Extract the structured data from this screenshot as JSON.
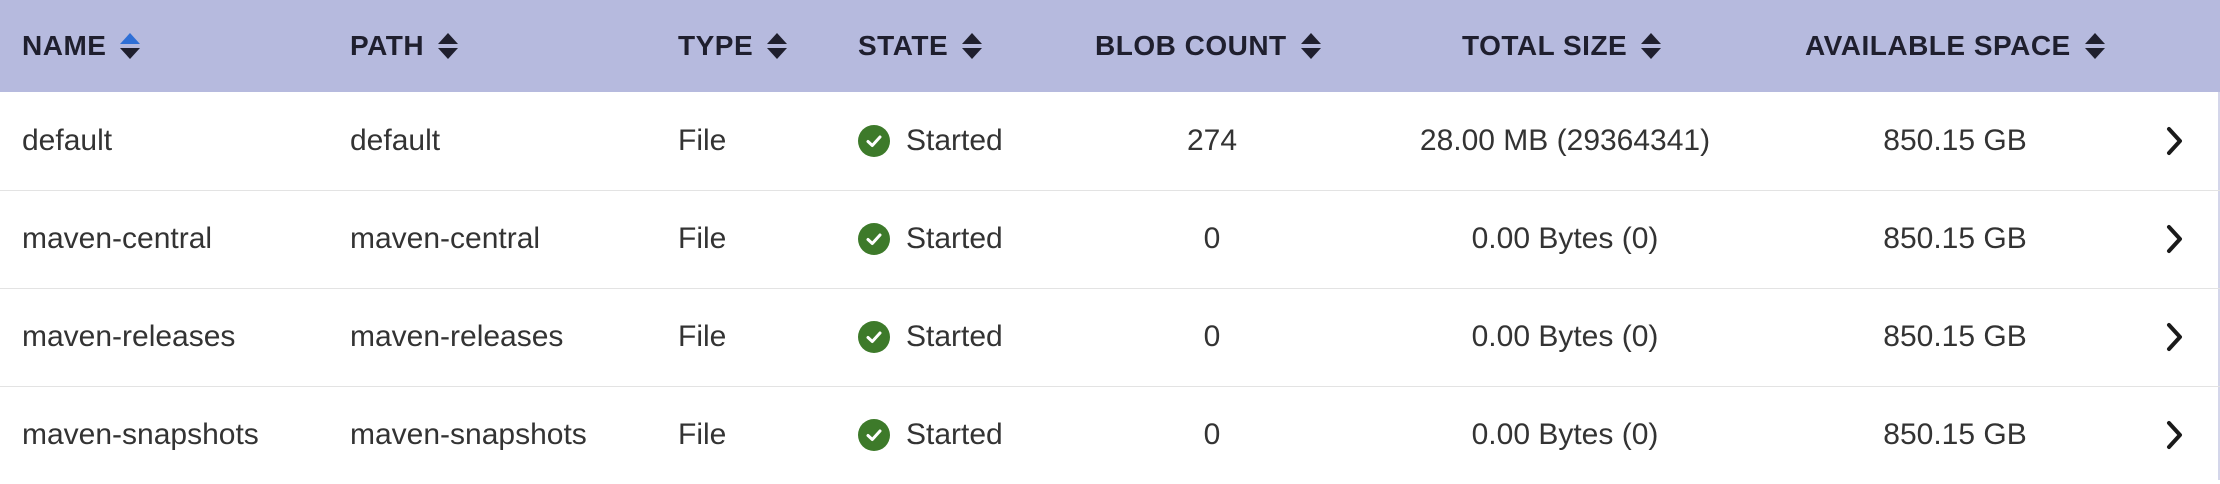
{
  "columns": [
    {
      "label": "NAME",
      "sort": "asc"
    },
    {
      "label": "PATH",
      "sort": "none"
    },
    {
      "label": "TYPE",
      "sort": "none"
    },
    {
      "label": "STATE",
      "sort": "none"
    },
    {
      "label": "BLOB COUNT",
      "sort": "none"
    },
    {
      "label": "TOTAL SIZE",
      "sort": "none"
    },
    {
      "label": "AVAILABLE SPACE",
      "sort": "none"
    }
  ],
  "rows": [
    {
      "name": "default",
      "path": "default",
      "type": "File",
      "state": "Started",
      "blob_count": "274",
      "total_size": "28.00 MB (29364341)",
      "available_space": "850.15 GB"
    },
    {
      "name": "maven-central",
      "path": "maven-central",
      "type": "File",
      "state": "Started",
      "blob_count": "0",
      "total_size": "0.00 Bytes (0)",
      "available_space": "850.15 GB"
    },
    {
      "name": "maven-releases",
      "path": "maven-releases",
      "type": "File",
      "state": "Started",
      "blob_count": "0",
      "total_size": "0.00 Bytes (0)",
      "available_space": "850.15 GB"
    },
    {
      "name": "maven-snapshots",
      "path": "maven-snapshots",
      "type": "File",
      "state": "Started",
      "blob_count": "0",
      "total_size": "0.00 Bytes (0)",
      "available_space": "850.15 GB"
    }
  ],
  "icons": {
    "state": "check-circle-icon",
    "row_action": "chevron-right-icon",
    "sort": "sort-icon"
  },
  "colors": {
    "header_bg": "#b6bade",
    "status_started": "#3d7a2a",
    "sort_active": "#2f6fd6"
  }
}
